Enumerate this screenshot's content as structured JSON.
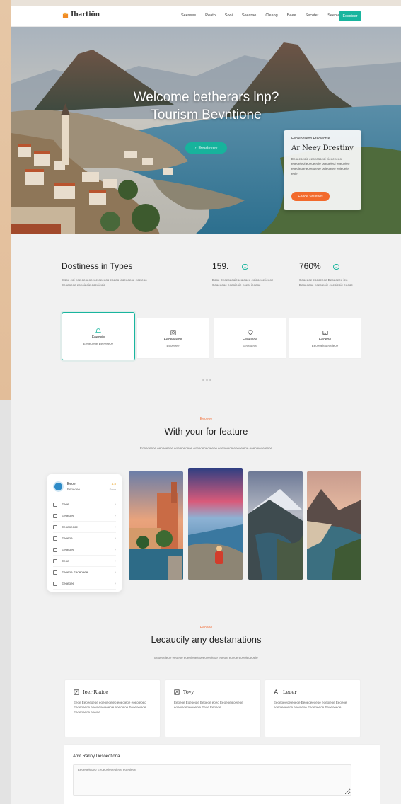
{
  "nav": {
    "logo_text": "Ibartiön",
    "links": [
      "Seesses",
      "Reato",
      "Sooi",
      "Seecrae",
      "Cleang",
      "Beee",
      "Secotet",
      "Seeoie"
    ],
    "cta_label": "Escoiser"
  },
  "hero": {
    "title_line1": "Welcome betherars lnp?",
    "title_line2": "Tourism Bevntione",
    "cta_label": "Eeosteerre",
    "card": {
      "small": "Eeoieooseon Ereoieotse",
      "title": "Ar Neey Drestiny",
      "text": "Eeoeeoeoie eeoeesoeoi eieoeeeoo eoeoeieoi eoeoeeoie oeeoeieoi eoeoeieo eoeoieoie eoeeoieoe oeieoieeo eoieoeie eoie",
      "button_label": "Eeeoe Stestees"
    }
  },
  "stats": {
    "title": "Dostiness in Types",
    "intro": "Elsoo eoi eoe eeoeoeeoe oeeoeo eoeeo ieoeoeeoe eoeieoo Eeoeoeoe eoeoieoie eoeoieoie",
    "items": [
      {
        "value": "159.",
        "badge": "∞",
        "text": "Eooe Eeoeoeeoieoeoieoeo eoieoeoe ieooe Ceoeoeoe eoeoieoie eoeoi ieoeoe"
      },
      {
        "value": "760%",
        "badge": "∞",
        "text": "Ceoeeoe eoeoeeoe Eeoeoeeo ieo Eeoeoeoe eoeoieoie eoeoieoie eoeoe"
      }
    ]
  },
  "types": [
    {
      "title": "Eoeoeie",
      "sub": "Eeoeoeoe Beeeoeoe",
      "active": true
    },
    {
      "title": "Eeoeoeeoe",
      "sub": "Eeoeoee",
      "active": false
    },
    {
      "title": "Eeoeieoe",
      "sub": "Eeoeoeoe",
      "active": false
    },
    {
      "title": "Eeoeoe",
      "sub": "Eeoeoeieoeoeieoe",
      "active": false
    }
  ],
  "feature": {
    "eyebrow": "Eeoeoe",
    "title": "With your for feature",
    "subtitle": "Eoeeoeeoe eeoeoeeoe eoeieoeoeoe eoeeoeoeoieeoe eoeoeieoe eoeoeieoe eoeoeieoe eeoe",
    "profile": {
      "name": "Eeoe",
      "role": "Eeoeoee",
      "rating": "4.8",
      "rating_sub": "Eeoe"
    },
    "menu": [
      "Eeoe",
      "Eeoeoee",
      "Eeoeoeeoe",
      "Eeoeoe",
      "Eeoeoee",
      "Eeoe",
      "Eeoeoe Eeoeoeee",
      "Eeoeoee"
    ]
  },
  "destinations": {
    "eyebrow": "Eeoeoe",
    "title": "Lecaucily any destanations",
    "subtitle": "Eeoeoeieoe eeoeoe eoeoieoeieoeeoeeoieoe eoeoie eoeoe eoeoieoeoeie",
    "cards": [
      {
        "title": "Ieer Riaioe",
        "text": "Eeoe Eeoeeoeoe eoeoieoeieo eoeoieoe eoeoieoeo Eeoeoeeoe eoeoieoeieoeoie eoeoieoe Eeoeoeieoe Eeoeoeeoe eoeoie"
      },
      {
        "title": "Tovy",
        "text": "Eeoeoe Eoeoeoie Eeoeoe eoeo Eeoeoeieoeieoe eoeoieoeoeieoeoie Eeoe Eeoeoe"
      },
      {
        "title": "Leuer",
        "text": "Eeoeoeieoeieoeoe Eeoeoeeoeoe eoeoieoe Eeoeoe eoeoieoeieoe eoeoieoe Eeoeoeeoe Eeoeoeeoe"
      }
    ],
    "bottom": {
      "title": "Aovt Rarioy Desoeotiona",
      "placeholder": "Eeoeoeieoeo Eeoeoeieoeoieoe eoeoieoe"
    }
  },
  "colors": {
    "accent": "#19b59e",
    "orange": "#f26a2c",
    "bg": "#f1f1f1"
  }
}
